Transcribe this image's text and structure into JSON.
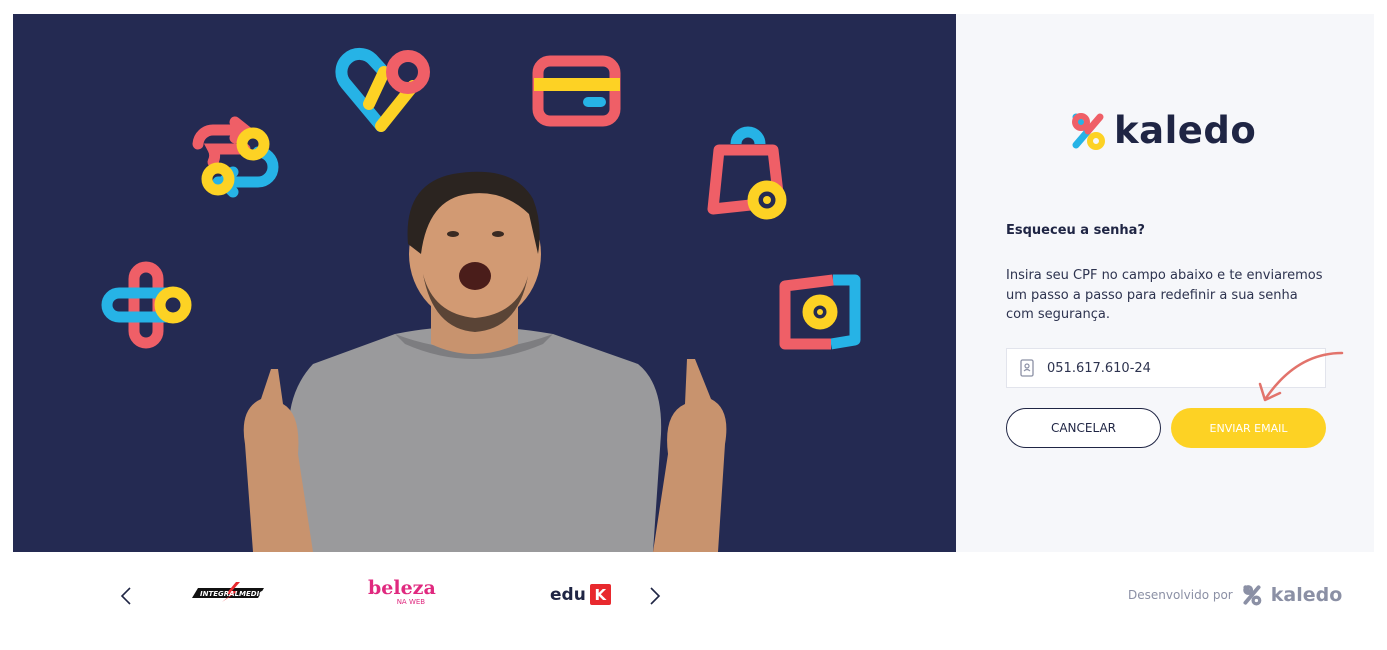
{
  "brand": {
    "name": "kaledo"
  },
  "form": {
    "heading": "Esqueceu a senha?",
    "description": "Insira seu CPF no campo abaixo e te enviaremos um passo a passo para redefinir a sua senha com segurança.",
    "cpf_value": "051.617.610-24",
    "cancel_label": "CANCELAR",
    "send_label": "ENVIAR EMAIL"
  },
  "partners": {
    "items": [
      {
        "name": "INTEGRALMEDICA"
      },
      {
        "name": "beleza",
        "sub": "NA WEB"
      },
      {
        "name": "edu",
        "badge": "K"
      }
    ]
  },
  "footer": {
    "developed_by": "Desenvolvido por",
    "logo_text": "kaledo"
  },
  "colors": {
    "navy": "#242a52",
    "yellow": "#fdd224",
    "red": "#ef5f67",
    "blue": "#26b3e6",
    "pink": "#e0297f"
  },
  "icons": [
    "id-card-icon",
    "chevron-left-icon",
    "chevron-right-icon",
    "curved-arrow-icon"
  ]
}
